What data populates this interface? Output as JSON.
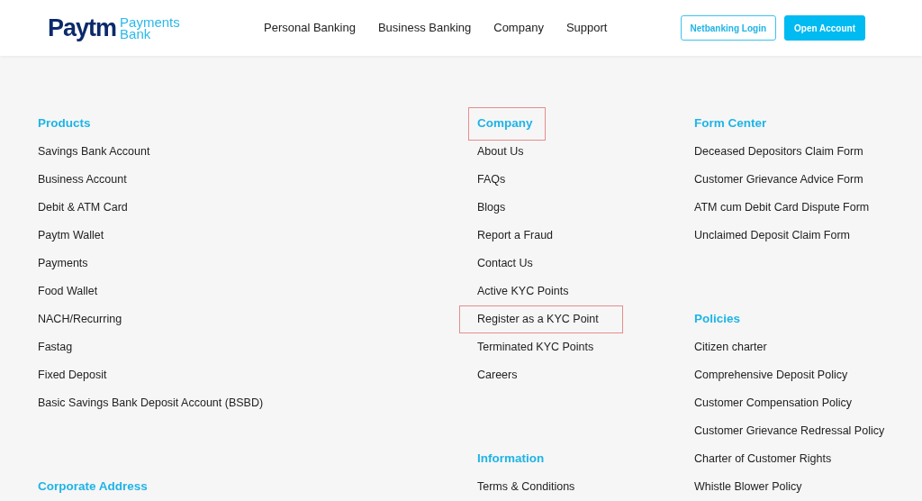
{
  "header": {
    "logo": {
      "wordmark": "Paytm",
      "tagline_top": "Payments",
      "tagline_bottom": "Bank"
    },
    "nav": [
      "Personal Banking",
      "Business Banking",
      "Company",
      "Support"
    ],
    "buttons": [
      {
        "label": "Netbanking Login",
        "kind": "outline"
      },
      {
        "label": "Open Account",
        "kind": "filled"
      }
    ]
  },
  "footer": {
    "columns": [
      {
        "sections": [
          {
            "title": "Products",
            "highlighted": false,
            "links": [
              {
                "label": "Savings Bank Account",
                "highlighted": false
              },
              {
                "label": "Business Account",
                "highlighted": false
              },
              {
                "label": "Debit & ATM Card",
                "highlighted": false
              },
              {
                "label": "Paytm Wallet",
                "highlighted": false
              },
              {
                "label": "Payments",
                "highlighted": false
              },
              {
                "label": "Food Wallet",
                "highlighted": false
              },
              {
                "label": "NACH/Recurring",
                "highlighted": false
              },
              {
                "label": "Fastag",
                "highlighted": false
              },
              {
                "label": "Fixed Deposit",
                "highlighted": false
              },
              {
                "label": "Basic Savings Bank Deposit Account (BSBD)",
                "highlighted": false
              }
            ]
          },
          {
            "title": "Corporate Address",
            "highlighted": false
          }
        ]
      },
      {
        "sections": [
          {
            "title": "Company",
            "highlighted": true,
            "links": [
              {
                "label": "About Us",
                "highlighted": false
              },
              {
                "label": "FAQs",
                "highlighted": false
              },
              {
                "label": "Blogs",
                "highlighted": false
              },
              {
                "label": "Report a Fraud",
                "highlighted": false
              },
              {
                "label": "Contact Us",
                "highlighted": false
              },
              {
                "label": "Active KYC Points",
                "highlighted": false
              },
              {
                "label": "Register as a KYC Point",
                "highlighted": true
              },
              {
                "label": "Terminated KYC Points",
                "highlighted": false
              },
              {
                "label": "Careers",
                "highlighted": false
              }
            ]
          },
          {
            "title": "Information",
            "highlighted": false,
            "links": [
              {
                "label": "Terms & Conditions",
                "highlighted": false
              }
            ]
          }
        ]
      },
      {
        "sections": [
          {
            "title": "Form Center",
            "highlighted": false,
            "links": [
              {
                "label": "Deceased Depositors Claim Form",
                "highlighted": false
              },
              {
                "label": "Customer Grievance Advice Form",
                "highlighted": false
              },
              {
                "label": "ATM cum Debit Card Dispute Form",
                "highlighted": false
              },
              {
                "label": "Unclaimed Deposit Claim Form",
                "highlighted": false
              }
            ]
          },
          {
            "title": "Policies",
            "highlighted": false,
            "links": [
              {
                "label": "Citizen charter",
                "highlighted": false
              },
              {
                "label": "Comprehensive Deposit Policy",
                "highlighted": false
              },
              {
                "label": "Customer Compensation Policy",
                "highlighted": false
              },
              {
                "label": "Customer Grievance Redressal Policy",
                "highlighted": false
              },
              {
                "label": "Charter of Customer Rights",
                "highlighted": false
              },
              {
                "label": "Whistle Blower Policy",
                "highlighted": false
              }
            ]
          }
        ]
      }
    ]
  }
}
